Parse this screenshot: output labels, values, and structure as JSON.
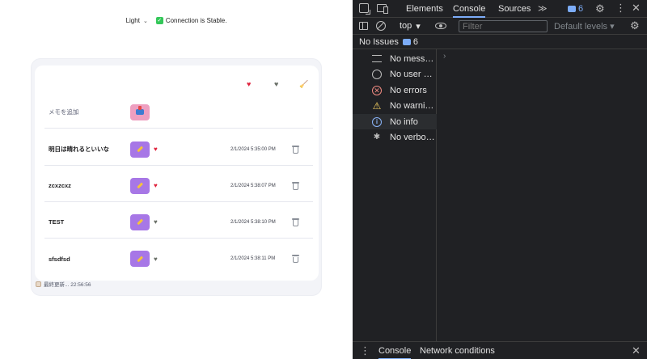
{
  "app": {
    "theme_value": "Light",
    "connection_text": "Connection is Stable.",
    "toolbar": {
      "heart_icon": "heart-red",
      "gray_heart_icon": "heart-gray",
      "broom_icon": "broom"
    },
    "add_memo_placeholder": "メモを追加",
    "memos": [
      {
        "text": "明日は晴れるといいな",
        "favorite": true,
        "date": "2/1/2024 5:35:00 PM"
      },
      {
        "text": "zcxzcxz",
        "favorite": true,
        "date": "2/1/2024 5:38:07 PM"
      },
      {
        "text": "TEST",
        "favorite": false,
        "date": "2/1/2024 5:38:10 PM"
      },
      {
        "text": "sfsdfsd",
        "favorite": false,
        "date": "2/1/2024 5:38:11 PM"
      }
    ],
    "footer_text": "最終更新... 22:56:56",
    "colors": {
      "heart_on": "#e0233d",
      "heart_off": "#6a7068",
      "edit_button": "#a777e6",
      "add_button": "#ee9fc0"
    }
  },
  "devtools": {
    "tabs": [
      "Elements",
      "Console",
      "Sources"
    ],
    "active_tab": "Console",
    "more_tabs": "≫",
    "message_count": "6",
    "context": "top",
    "filter_placeholder": "Filter",
    "levels": "Default levels ▾",
    "issues_label": "No Issues",
    "issues_count": "6",
    "sidebar": [
      {
        "label": "No messages",
        "icon": "list-icon"
      },
      {
        "label": "No user messages",
        "icon": "user-icon"
      },
      {
        "label": "No errors",
        "icon": "error-icon"
      },
      {
        "label": "No warnings",
        "icon": "warning-icon"
      },
      {
        "label": "No info",
        "icon": "info-icon"
      },
      {
        "label": "No verbose",
        "icon": "bug-icon"
      }
    ],
    "drawer_tabs": [
      "Console",
      "Network conditions"
    ],
    "colors": {
      "background": "#202124",
      "accent": "#7cacf8"
    }
  }
}
